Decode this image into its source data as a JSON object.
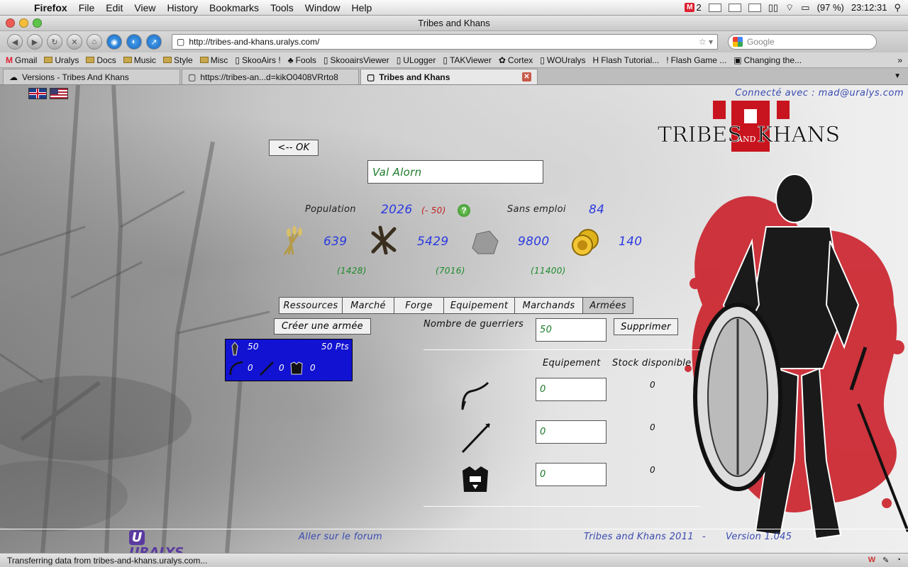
{
  "menubar": {
    "app": "Firefox",
    "items": [
      "File",
      "Edit",
      "View",
      "History",
      "Bookmarks",
      "Tools",
      "Window",
      "Help"
    ],
    "mail_count": "2",
    "battery": "(97 %)",
    "clock": "23:12:31"
  },
  "window": {
    "title": "Tribes and Khans"
  },
  "toolbar": {
    "url": "http://tribes-and-khans.uralys.com/",
    "search_placeholder": "Google"
  },
  "bookmarks": [
    {
      "label": "Gmail",
      "icon": "gmail-icon"
    },
    {
      "label": "Uralys",
      "icon": "folder-icon"
    },
    {
      "label": "Docs",
      "icon": "folder-icon"
    },
    {
      "label": "Music",
      "icon": "folder-icon"
    },
    {
      "label": "Style",
      "icon": "folder-icon"
    },
    {
      "label": "Misc",
      "icon": "folder-icon"
    },
    {
      "label": "SkooAirs !",
      "icon": "page-icon"
    },
    {
      "label": "Fools",
      "icon": "page-icon"
    },
    {
      "label": "SkooairsViewer",
      "icon": "page-icon"
    },
    {
      "label": "ULogger",
      "icon": "page-icon"
    },
    {
      "label": "TAKViewer",
      "icon": "page-icon"
    },
    {
      "label": "Cortex",
      "icon": "page-icon"
    },
    {
      "label": "WOUralys",
      "icon": "page-icon"
    },
    {
      "label": "Flash Tutorial...",
      "icon": "page-icon"
    },
    {
      "label": "Flash Game ...",
      "icon": "page-icon"
    },
    {
      "label": "Changing the...",
      "icon": "page-icon"
    }
  ],
  "tabs": [
    {
      "label": "Versions - Tribes And Khans",
      "active": false
    },
    {
      "label": "https://tribes-an...d=kikO0408VRrto8",
      "active": false
    },
    {
      "label": "Tribes and Khans",
      "active": true
    }
  ],
  "header": {
    "connected": "Connecté avec : mad@uralys.com",
    "logo_text_left": "TRIBES",
    "logo_text_mid": "AND",
    "logo_text_right": "KHANS"
  },
  "game": {
    "back_button": "<-- OK",
    "city_name": "Val Alorn",
    "population_label": "Population",
    "population_value": "2026",
    "population_delta": "(- 50)",
    "unemployed_label": "Sans emploi",
    "unemployed_value": "84",
    "resources": [
      {
        "name": "wheat",
        "value": "639",
        "capacity": "(1428)"
      },
      {
        "name": "wood",
        "value": "5429",
        "capacity": "(7016)"
      },
      {
        "name": "stone",
        "value": "9800",
        "capacity": "(11400)"
      },
      {
        "name": "gold",
        "value": "140",
        "capacity": ""
      }
    ],
    "tabs": [
      "Ressources",
      "Marché",
      "Forge",
      "Equipement",
      "Marchands",
      "Armées"
    ],
    "active_tab": "Armées",
    "create_army": "Créer une armée",
    "army_card": {
      "count": "50",
      "points": "50 Pts",
      "bows": "0",
      "spears": "0",
      "armors": "0"
    },
    "warriors_label": "Nombre de guerriers",
    "warriors_value": "50",
    "delete_button": "Supprimer",
    "col_equipment": "Equipement",
    "col_stock": "Stock disponible",
    "equipment_rows": [
      {
        "icon": "bow-icon",
        "value": "0",
        "stock": "0"
      },
      {
        "icon": "spear-icon",
        "value": "0",
        "stock": "0"
      },
      {
        "icon": "armor-icon",
        "value": "0",
        "stock": "0"
      }
    ]
  },
  "footer": {
    "brand": "URALYS",
    "forum_link": "Aller sur le forum",
    "copyright": "Tribes and Khans 2011",
    "separator": "-",
    "version": "Version 1.045"
  },
  "status": {
    "text": "Transferring data from tribes-and-khans.uralys.com..."
  },
  "colors": {
    "accent_blue": "#2b3ae0",
    "army_card": "#1212d2",
    "green_text": "#1d8a2a",
    "red_text": "#c02020",
    "splash_red": "#c8141e"
  }
}
